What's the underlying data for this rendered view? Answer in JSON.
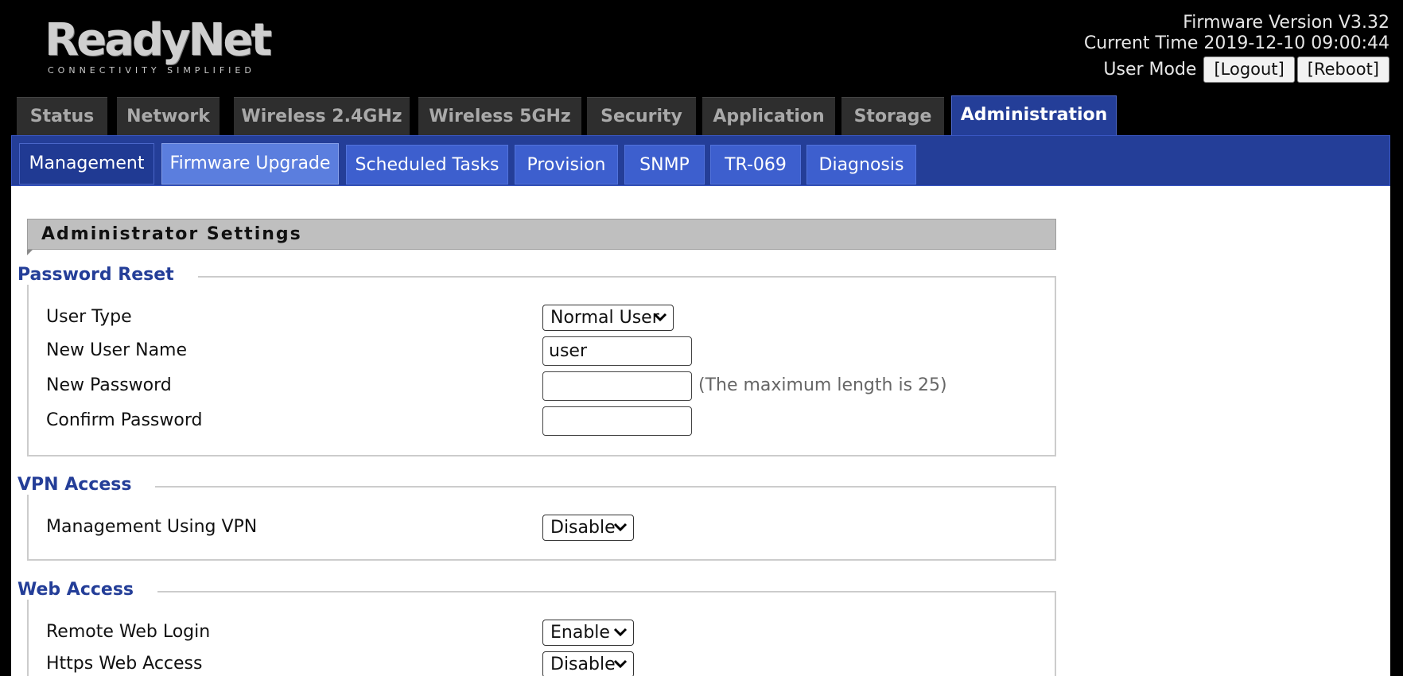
{
  "header": {
    "logo_name": "ReadyNet",
    "logo_tagline": "CONNECTIVITY SIMPLIFIED",
    "firmware_version": "Firmware Version V3.32",
    "current_time": "Current Time 2019-12-10 09:00:44",
    "user_mode": "User Mode",
    "logout_label": "[Logout]",
    "reboot_label": "[Reboot]"
  },
  "main_tabs": [
    {
      "label": "Status"
    },
    {
      "label": "Network"
    },
    {
      "label": "Wireless 2.4GHz"
    },
    {
      "label": "Wireless 5GHz"
    },
    {
      "label": "Security"
    },
    {
      "label": "Application"
    },
    {
      "label": "Storage"
    },
    {
      "label": "Administration",
      "active": true
    }
  ],
  "sub_tabs": [
    {
      "label": "Management",
      "active": true
    },
    {
      "label": "Firmware Upgrade",
      "hover": true
    },
    {
      "label": "Scheduled Tasks"
    },
    {
      "label": "Provision"
    },
    {
      "label": "SNMP"
    },
    {
      "label": "TR-069"
    },
    {
      "label": "Diagnosis"
    }
  ],
  "section_title": "Administrator Settings",
  "password_reset": {
    "legend": "Password Reset",
    "user_type_label": "User Type",
    "user_type_value": "Normal User",
    "new_user_name_label": "New User Name",
    "new_user_name_value": "user",
    "new_password_label": "New Password",
    "new_password_value": "",
    "max_length_hint": "(The maximum length is 25)",
    "confirm_password_label": "Confirm Password",
    "confirm_password_value": ""
  },
  "vpn_access": {
    "legend": "VPN Access",
    "management_vpn_label": "Management Using VPN",
    "management_vpn_value": "Disable"
  },
  "web_access": {
    "legend": "Web Access",
    "remote_web_login_label": "Remote Web Login",
    "remote_web_login_value": "Enable",
    "https_web_access_label": "Https Web Access",
    "https_web_access_value": "Disable"
  },
  "colors": {
    "accent_blue": "#243e98",
    "tab_blue": "#3d5fce",
    "inactive_tab": "#2e2e2e",
    "section_bar": "#bfbfbf"
  }
}
